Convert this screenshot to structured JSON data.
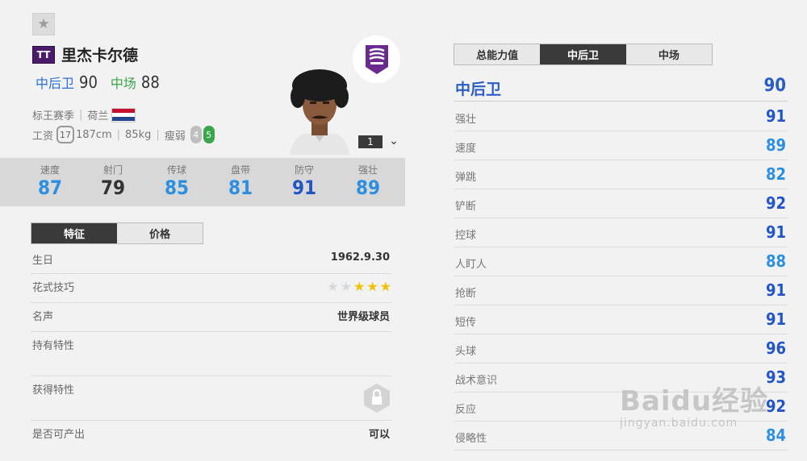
{
  "player": {
    "season_tag": "TT",
    "name": "里杰卡尔德",
    "pos1": "中后卫",
    "pos1_ovr": "90",
    "pos2": "中场",
    "pos2_ovr": "88",
    "season": "标王赛季",
    "nation": "荷兰",
    "salary_label": "工资",
    "salary": "17",
    "height": "187cm",
    "weight": "85kg",
    "body": "瘦弱",
    "weak_foot": "4",
    "strong_foot": "5",
    "rank": "1"
  },
  "stats": [
    {
      "label": "速度",
      "value": "87",
      "color": "#2d8fe0"
    },
    {
      "label": "射门",
      "value": "79",
      "color": "#333333"
    },
    {
      "label": "传球",
      "value": "85",
      "color": "#2d8fe0"
    },
    {
      "label": "盘带",
      "value": "81",
      "color": "#2d8fe0"
    },
    {
      "label": "防守",
      "value": "91",
      "color": "#2156c7"
    },
    {
      "label": "强壮",
      "value": "89",
      "color": "#2d8fe0"
    }
  ],
  "left_tabs": {
    "t1": "特征",
    "t2": "价格"
  },
  "info": {
    "birthday_label": "生日",
    "birthday": "1962.9.30",
    "skill_label": "花式技巧",
    "skill_stars": 3,
    "fame_label": "名声",
    "fame": "世界级球员",
    "traits_label": "持有特性",
    "acquired_label": "获得特性",
    "producible_label": "是否可产出",
    "producible": "可以"
  },
  "right_tabs": {
    "t1": "总能力值",
    "t2": "中后卫",
    "t3": "中场"
  },
  "position_header": {
    "label": "中后卫",
    "value": "90"
  },
  "attributes": [
    {
      "label": "强壮",
      "value": "91"
    },
    {
      "label": "速度",
      "value": "89"
    },
    {
      "label": "弹跳",
      "value": "82"
    },
    {
      "label": "铲断",
      "value": "92"
    },
    {
      "label": "控球",
      "value": "91"
    },
    {
      "label": "人盯人",
      "value": "88"
    },
    {
      "label": "抢断",
      "value": "91"
    },
    {
      "label": "短传",
      "value": "91"
    },
    {
      "label": "头球",
      "value": "96"
    },
    {
      "label": "战术意识",
      "value": "93"
    },
    {
      "label": "反应",
      "value": "92"
    },
    {
      "label": "侵略性",
      "value": "84"
    }
  ],
  "colors": {
    "accent_dark_blue": "#2156c7",
    "accent_light_blue": "#2d8fe0",
    "season_purple": "#4a1a6b",
    "pos2_green": "#3aa64a"
  },
  "watermark": {
    "logo": "Baidu经验",
    "url": "jingyan.baidu.com"
  }
}
